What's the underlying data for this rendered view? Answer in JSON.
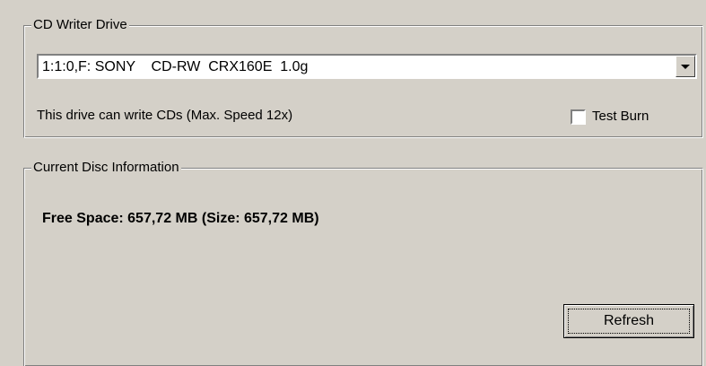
{
  "writer_group": {
    "legend": "CD Writer Drive",
    "drive_select": {
      "value": "1:1:0,F: SONY    CD-RW  CRX160E  1.0g"
    },
    "drive_info": "This drive can write CDs (Max. Speed 12x)",
    "test_burn": {
      "label": "Test Burn",
      "checked": false
    }
  },
  "disc_group": {
    "legend": "Current Disc Information",
    "free_space": "Free Space: 657,72 MB (Size: 657,72 MB)",
    "refresh_label": "Refresh"
  },
  "icons": {
    "dropdown": "chevron-down-icon"
  }
}
